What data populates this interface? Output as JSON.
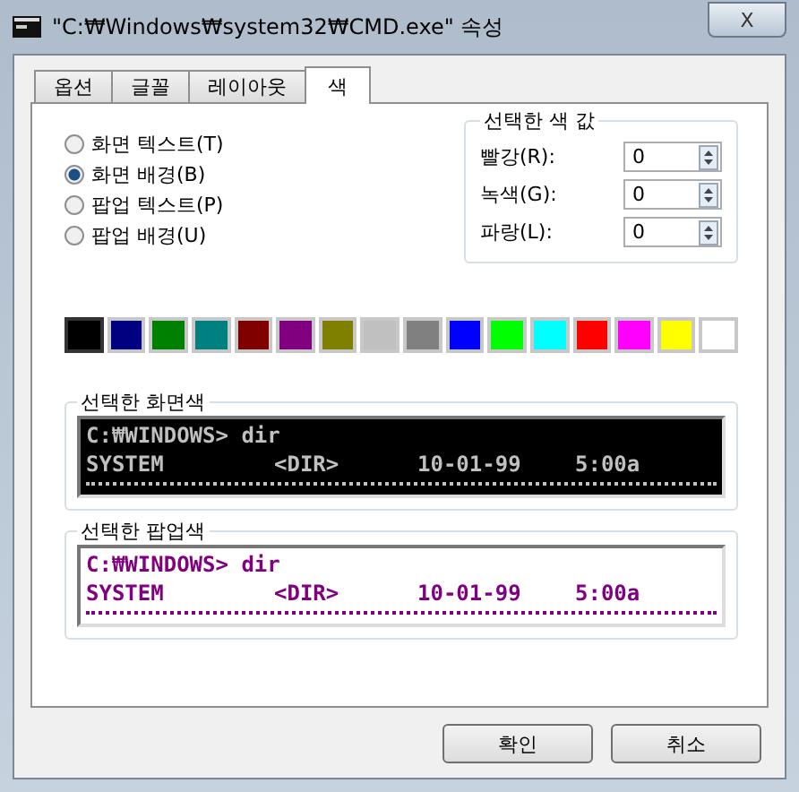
{
  "window": {
    "title": "\"C:₩Windows₩system32₩CMD.exe\" 속성",
    "close": "X"
  },
  "tabs": [
    {
      "label": "옵션",
      "selected": false
    },
    {
      "label": "글꼴",
      "selected": false
    },
    {
      "label": "레이아웃",
      "selected": false
    },
    {
      "label": "색",
      "selected": true
    }
  ],
  "color_targets": [
    {
      "label": "화면 텍스트(T)",
      "selected": false
    },
    {
      "label": "화면 배경(B)",
      "selected": true
    },
    {
      "label": "팝업 텍스트(P)",
      "selected": false
    },
    {
      "label": "팝업 배경(U)",
      "selected": false
    }
  ],
  "selected_color_values": {
    "title": "선택한 색 값",
    "fields": [
      {
        "label": "빨강(R):",
        "value": "0"
      },
      {
        "label": "녹색(G):",
        "value": "0"
      },
      {
        "label": "파랑(L):",
        "value": "0"
      }
    ]
  },
  "palette": [
    {
      "color": "#000000",
      "selected": true
    },
    {
      "color": "#000080",
      "selected": false
    },
    {
      "color": "#008000",
      "selected": false
    },
    {
      "color": "#008080",
      "selected": false
    },
    {
      "color": "#800000",
      "selected": false
    },
    {
      "color": "#800080",
      "selected": false
    },
    {
      "color": "#808000",
      "selected": false
    },
    {
      "color": "#c0c0c0",
      "selected": false
    },
    {
      "color": "#808080",
      "selected": false
    },
    {
      "color": "#0000ff",
      "selected": false
    },
    {
      "color": "#00ff00",
      "selected": false
    },
    {
      "color": "#00ffff",
      "selected": false
    },
    {
      "color": "#ff0000",
      "selected": false
    },
    {
      "color": "#ff00ff",
      "selected": false
    },
    {
      "color": "#ffff00",
      "selected": false
    },
    {
      "color": "#ffffff",
      "selected": false
    }
  ],
  "previews": [
    {
      "title": "선택한 화면색",
      "kind": "screen",
      "color": "#c0c0c0",
      "lines": [
        [
          "C:₩WINDOWS> dir"
        ],
        [
          "SYSTEM",
          "<DIR>",
          "10-01-99",
          "5:00a"
        ]
      ]
    },
    {
      "title": "선택한 팝업색",
      "kind": "popup",
      "color": "#800080",
      "lines": [
        [
          "C:₩WINDOWS> dir"
        ],
        [
          "SYSTEM",
          "<DIR>",
          "10-01-99",
          "5:00a"
        ]
      ]
    }
  ],
  "buttons": [
    "확인",
    "취소"
  ]
}
